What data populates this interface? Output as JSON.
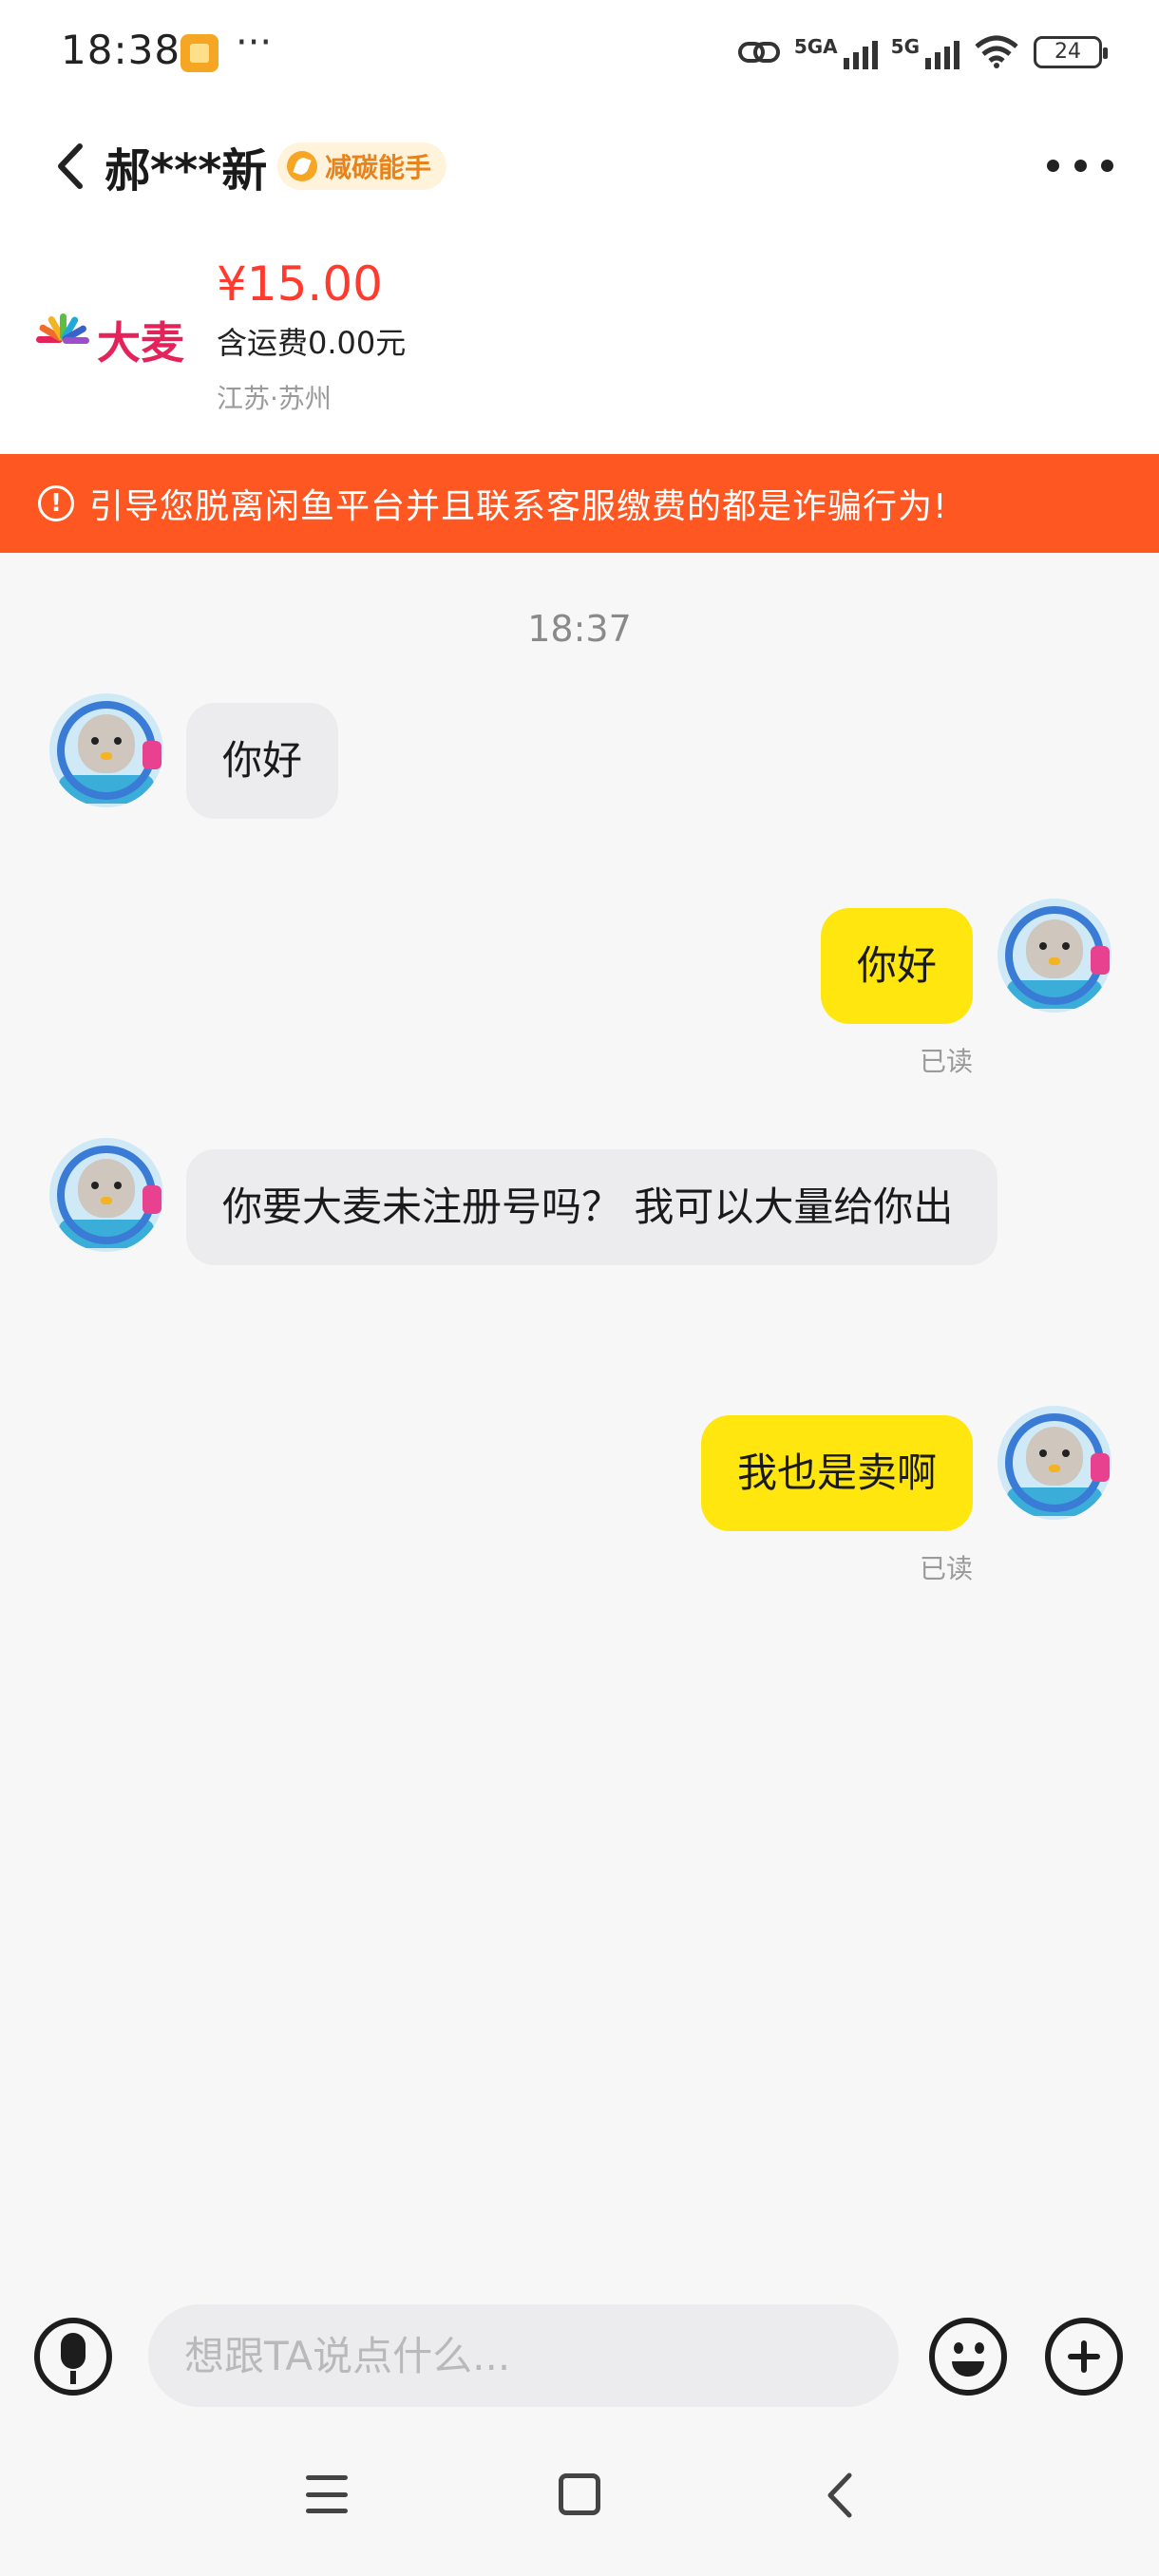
{
  "status_bar": {
    "time": "18:38",
    "more": "···",
    "signal1_label": "5GA",
    "signal2_label": "5G",
    "battery": "24"
  },
  "header": {
    "peer_name": "郝***新",
    "badge": "减碳能手"
  },
  "product": {
    "logo_text": "大麦",
    "price": "¥15.00",
    "shipping": "含运费0.00元",
    "location": "江苏·苏州"
  },
  "warning": {
    "icon": "!",
    "text": "引导您脱离闲鱼平台并且联系客服缴费的都是诈骗行为!"
  },
  "chat": {
    "timestamp": "18:37",
    "messages": [
      {
        "side": "in",
        "text": "你好"
      },
      {
        "side": "out",
        "text": "你好",
        "status": "已读"
      },
      {
        "side": "in",
        "text": "你要大麦未注册号吗？ 我可以大量给你出"
      },
      {
        "side": "out",
        "text": "我也是卖啊",
        "status": "已读"
      }
    ]
  },
  "input": {
    "placeholder": "想跟TA说点什么..."
  },
  "colors": {
    "accent_red": "#ff3b30",
    "warning_bg": "#ff5722",
    "out_bubble": "#ffe60f",
    "in_bubble": "#ececef"
  },
  "icons": [
    "back-icon",
    "more-icon",
    "mic-icon",
    "emoji-icon",
    "plus-icon",
    "warning-icon",
    "nav-menu-icon",
    "nav-home-icon",
    "nav-back-icon"
  ]
}
